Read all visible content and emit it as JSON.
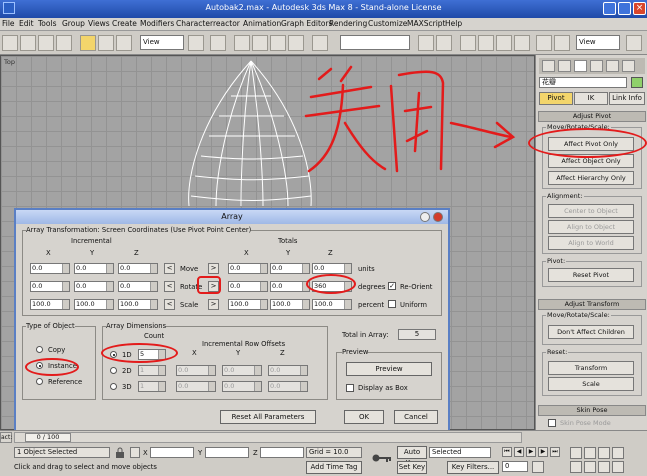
{
  "window": {
    "title": "Autobak2.max - Autodesk 3ds Max 8 - Stand-alone License"
  },
  "menu": [
    "File",
    "Edit",
    "Tools",
    "Group",
    "Views",
    "Create",
    "Modifiers",
    "Character",
    "reactor",
    "Animation",
    "Graph Editors",
    "Rendering",
    "Customize",
    "MAXScript",
    "Help"
  ],
  "toolbar": {
    "viewSelect": "View",
    "viewSelect2": "View"
  },
  "viewport": {
    "label": "Top"
  },
  "annotation": {
    "text": "关闭",
    "color": "#e31b1b"
  },
  "panel": {
    "name": "花瓣",
    "tabs": [
      "Pivot",
      "IK",
      "Link Info"
    ],
    "adjustPivot": "Adjust Pivot",
    "moveRotateScale": "Move/Rotate/Scale:",
    "affectPivotOnly": "Affect Pivot Only",
    "affectObjectOnly": "Affect Object Only",
    "affectHierarchyOnly": "Affect Hierarchy Only",
    "alignment": "Alignment:",
    "centerToObject": "Center to Object",
    "alignToObject": "Align to Object",
    "alignToWorld": "Align to World",
    "pivot": "Pivot:",
    "resetPivot": "Reset Pivot",
    "adjustTransform": "Adjust Transform",
    "moveRotateScale2": "Move/Rotate/Scale:",
    "dontAffectChildren": "Don't Affect Children",
    "reset": "Reset:",
    "transform": "Transform",
    "scale": "Scale",
    "skinPose": "Skin Pose",
    "skinPoseMode": "Skin Pose Mode"
  },
  "dialog": {
    "title": "Array",
    "transformHeader": "Array Transformation: Screen Coordinates (Use Pivot Point Center)",
    "incremental": "Incremental",
    "totals": "Totals",
    "axes": [
      "X",
      "Y",
      "Z"
    ],
    "rows": [
      {
        "label": "Move",
        "inc": [
          "0.0",
          "0.0",
          "0.0"
        ],
        "tot": [
          "0.0",
          "0.0",
          "0.0"
        ],
        "unit": "units"
      },
      {
        "label": "Rotate",
        "inc": [
          "0.0",
          "0.0",
          "0.0"
        ],
        "tot": [
          "0.0",
          "0.0",
          "360"
        ],
        "unit": "degrees"
      },
      {
        "label": "Scale",
        "inc": [
          "100.0",
          "100.0",
          "100.0"
        ],
        "tot": [
          "100.0",
          "100.0",
          "100.0"
        ],
        "unit": "percent"
      }
    ],
    "reOrient": "Re-Orient",
    "uniform": "Uniform",
    "typeOfObject": "Type of Object",
    "copy": "Copy",
    "instance": "Instance",
    "reference": "Reference",
    "arrayDimensions": "Array Dimensions",
    "count": "Count",
    "incRowOffsets": "Incremental Row Offsets",
    "dims": [
      {
        "label": "1D",
        "count": "5"
      },
      {
        "label": "2D",
        "count": "1",
        "off": [
          "0.0",
          "0.0",
          "0.0"
        ]
      },
      {
        "label": "3D",
        "count": "1",
        "off": [
          "0.0",
          "0.0",
          "0.0"
        ]
      }
    ],
    "totalInArrayLabel": "Total in Array:",
    "totalInArray": "5",
    "preview": "Preview",
    "previewBtn": "Preview",
    "displayAsBox": "Display as Box",
    "resetAll": "Reset All Parameters",
    "ok": "OK",
    "cancel": "Cancel"
  },
  "status": {
    "timeSlider": "0 / 100",
    "selected": "1 Object Selected",
    "prompt": "Click and drag to select and move objects",
    "xLabel": "X",
    "yLabel": "Y",
    "zLabel": "Z",
    "grid": "Grid = 10.0",
    "addTimeTag": "Add Time Tag",
    "autoKey": "Auto Key",
    "setKey": "Set Key",
    "keySelected": "Selected",
    "keyFilters": "Key Filters...",
    "frame": "0",
    "leftTab": "act:"
  }
}
